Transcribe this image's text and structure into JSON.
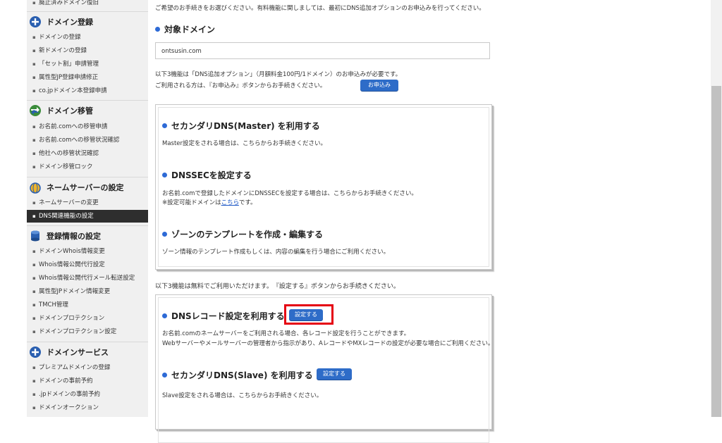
{
  "sidebar": {
    "top_item": "廃止済みドメイン復旧",
    "groups": [
      {
        "title": "ドメイン登録",
        "icon": "plus-circle-icon",
        "items": [
          "ドメインの登録",
          "新ドメインの登録",
          "「セット割」申請管理",
          "属性型JP登録申請修正",
          "co.jpドメイン本登録申請"
        ]
      },
      {
        "title": "ドメイン移管",
        "icon": "transfer-arrows-icon",
        "items": [
          "お名前.comへの移管申請",
          "お名前.comへの移管状況確認",
          "他社への移管状況確認",
          "ドメイン移管ロック"
        ]
      },
      {
        "title": "ネームサーバーの設定",
        "icon": "nameserver-globe-icon",
        "items": [
          "ネームサーバーの変更",
          "DNS関連機能の設定"
        ]
      },
      {
        "title": "登録情報の設定",
        "icon": "database-icon",
        "items": [
          "ドメインWhois情報変更",
          "Whois情報公開代行設定",
          "Whois情報公開代行メール転送設定",
          "属性型JPドメイン情報変更",
          "TMCH管理",
          "ドメインプロテクション",
          "ドメインプロテクション設定"
        ]
      },
      {
        "title": "ドメインサービス",
        "icon": "plus-circle-icon",
        "items": [
          "プレミアムドメインの登録",
          "ドメインの事前予約",
          ".jpドメインの事前予約",
          "ドメインオークション"
        ]
      }
    ],
    "active_item": "DNS関連機能の設定"
  },
  "main": {
    "intro": "ご希望のお手続きをお選びください。有料機能に関しましては、最初にDNS追加オプションのお申込みを行ってください。",
    "target_domain_title": "対象ドメイン",
    "domain_value": "ontsusin.com",
    "paid_note_1": "以下3機能は「DNS追加オプション」（月額料金100円/1ドメイン）のお申込みが必要です。",
    "paid_note_2": "ご利用される方は、『お申込み』ボタンからお手続きください。",
    "apply_button": "お申込み",
    "paid_features": {
      "secondary_master_title": "セカンダリDNS(Master) を利用する",
      "secondary_master_desc": "Master設定をされる場合は、こちらからお手続きください。",
      "dnssec_title": "DNSSECを設定する",
      "dnssec_desc": "お名前.comで登録したドメインにDNSSECを設定する場合は、こちらからお手続きください。",
      "dnssec_note_pre": "※設定可能ドメインは",
      "dnssec_note_link": "こちら",
      "dnssec_note_post": "です。",
      "zone_title": "ゾーンのテンプレートを作成・編集する",
      "zone_desc": "ゾーン情報のテンプレート作成もしくは、内容の編集を行う場合にご利用ください。"
    },
    "free_note": "以下3機能は無料でご利用いただけます。　『設定する』ボタンからお手続きください。",
    "free_features": {
      "dns_record_title": "DNSレコード設定を利用する",
      "dns_record_button": "設定する",
      "dns_record_desc_1": "お名前.comのネームサーバーをご利用される場合、各レコード設定を行うことができます。",
      "dns_record_desc_2": "Webサーバーやメールサーバーの管理者から指示があり、AレコードやMXレコードの設定が必要な場合にご利用ください。",
      "slave_title": "セカンダリDNS(Slave) を利用する",
      "slave_button": "設定する",
      "slave_desc": "Slave設定をされる場合は、こちらからお手続きください。"
    }
  },
  "colors": {
    "accent_blue": "#2e6cc8",
    "highlight_red": "#e50012",
    "active_nav": "#2e2e2e"
  }
}
